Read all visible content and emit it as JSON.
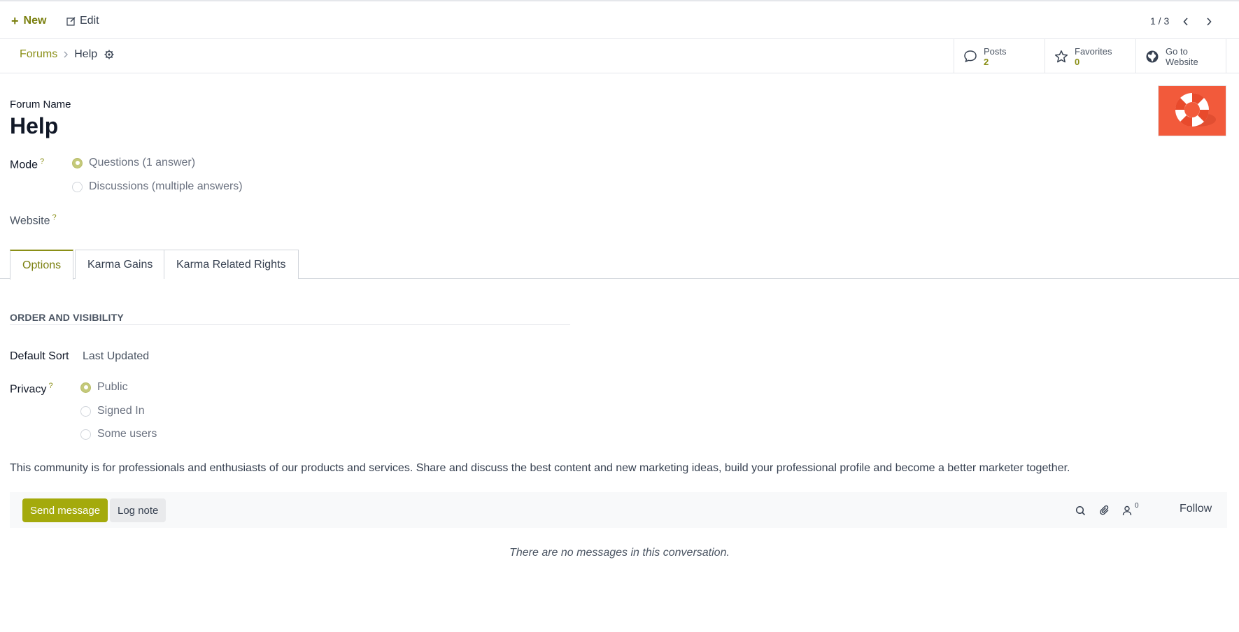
{
  "control_panel": {
    "new_label": "New",
    "edit_label": "Edit",
    "pager": "1 / 3"
  },
  "breadcrumb": {
    "parent": "Forums",
    "current": "Help"
  },
  "smart_buttons": [
    {
      "label": "Posts",
      "value": "2",
      "icon": "chat-bubble-icon"
    },
    {
      "label": "Favorites",
      "value": "0",
      "icon": "star-icon"
    },
    {
      "label": "Go to",
      "label2": "Website",
      "icon": "globe-icon"
    }
  ],
  "form": {
    "forum_name_label": "Forum Name",
    "forum_name": "Help",
    "mode_label": "Mode",
    "mode_options": [
      {
        "label": "Questions (1 answer)",
        "checked": true
      },
      {
        "label": "Discussions (multiple answers)",
        "checked": false
      }
    ],
    "website_label": "Website",
    "help_marker": "?"
  },
  "tabs": [
    "Options",
    "Karma Gains",
    "Karma Related Rights"
  ],
  "options_tab": {
    "section_title": "ORDER AND VISIBILITY",
    "default_sort_label": "Default Sort",
    "default_sort_value": "Last Updated",
    "privacy_label": "Privacy",
    "privacy_options": [
      {
        "label": "Public",
        "checked": true
      },
      {
        "label": "Signed In",
        "checked": false
      },
      {
        "label": "Some users",
        "checked": false
      }
    ],
    "description": "This community is for professionals and enthusiasts of our products and services. Share and discuss the best content and new marketing ideas, build your professional profile and become a better marketer together."
  },
  "chatter": {
    "send_message": "Send message",
    "log_note": "Log note",
    "follower_count": "0",
    "follow": "Follow",
    "empty_message": "There are no messages in this conversation."
  },
  "colors": {
    "brand": "#8a8f16",
    "send_button": "#a4aa0c",
    "forum_image_bg": "#f25a3b"
  }
}
